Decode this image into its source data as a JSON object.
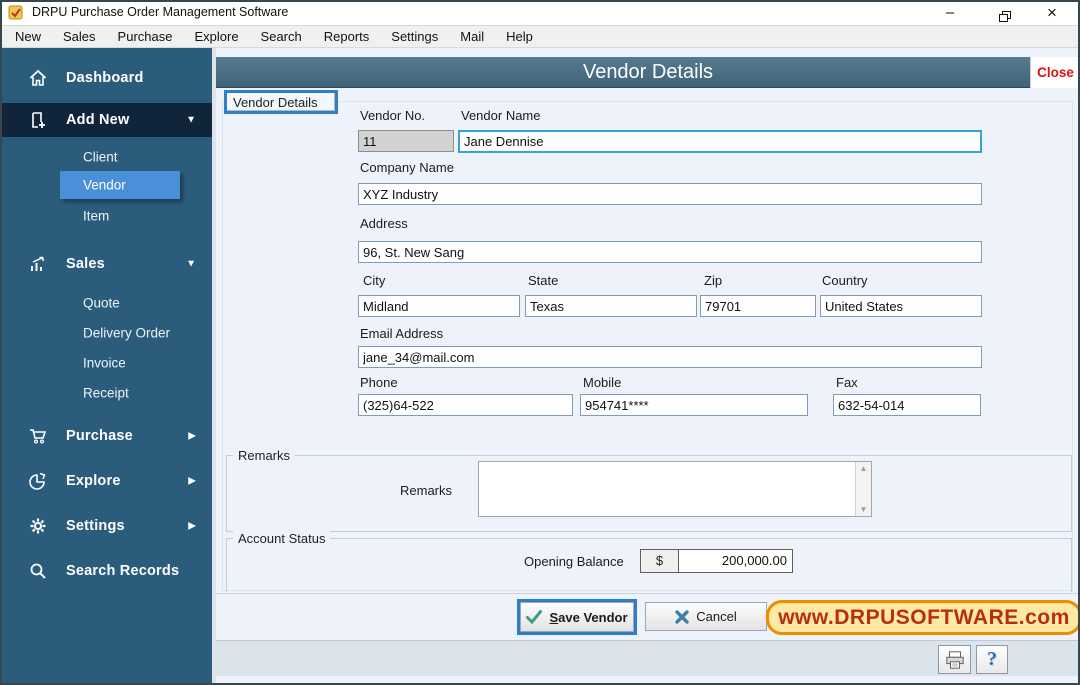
{
  "window": {
    "title": "DRPU Purchase Order Management Software"
  },
  "menu": {
    "items": [
      "New",
      "Sales",
      "Purchase",
      "Explore",
      "Search",
      "Reports",
      "Settings",
      "Mail",
      "Help"
    ]
  },
  "sidebar": {
    "dashboard": "Dashboard",
    "add_new": "Add New",
    "client": "Client",
    "vendor": "Vendor",
    "item": "Item",
    "sales": "Sales",
    "quote": "Quote",
    "delivery_order": "Delivery Order",
    "invoice": "Invoice",
    "receipt": "Receipt",
    "purchase": "Purchase",
    "explore": "Explore",
    "settings": "Settings",
    "search_records": "Search Records"
  },
  "header": {
    "title": "Vendor Details",
    "close": "Close"
  },
  "form": {
    "tab": "Vendor Details",
    "vendor_no": {
      "label": "Vendor No.",
      "value": "11"
    },
    "vendor_name": {
      "label": "Vendor Name",
      "value": "Jane Dennise"
    },
    "company_name": {
      "label": "Company Name",
      "value": "XYZ Industry"
    },
    "address": {
      "label": "Address",
      "value": "96, St. New Sang"
    },
    "city": {
      "label": "City",
      "value": "Midland"
    },
    "state": {
      "label": "State",
      "value": "Texas"
    },
    "zip": {
      "label": "Zip",
      "value": "79701"
    },
    "country": {
      "label": "Country",
      "value": "United States"
    },
    "email": {
      "label": "Email Address",
      "value": "jane_34@mail.com"
    },
    "phone": {
      "label": "Phone",
      "value": "(325)64-522"
    },
    "mobile": {
      "label": "Mobile",
      "value": "954741****"
    },
    "fax": {
      "label": "Fax",
      "value": "632-54-014"
    },
    "remarks_group": "Remarks",
    "remarks_label": "Remarks",
    "remarks_value": "",
    "account_group": "Account Status",
    "opening_balance_label": "Opening Balance",
    "currency": "$",
    "opening_balance_value": "200,000.00"
  },
  "actions": {
    "save_underlined": "S",
    "save_rest": "ave Vendor",
    "cancel": "Cancel"
  },
  "watermark": "www.DRPUSOFTWARE.com",
  "icons": {
    "chevron_down": "▼",
    "chevron_right": "▶",
    "minimize": "–",
    "close_x": "×",
    "help": "?",
    "scroll_up": "▲",
    "scroll_down": "▼"
  },
  "colors": {
    "sidebar_bg": "#2b5c7c",
    "active_item": "#4a90d8",
    "header_bar": "#4b7186",
    "close_text": "#e01010",
    "annotation": "#2f7ec7",
    "watermark_text": "#b82e10",
    "watermark_bg": "#ffe9a2"
  }
}
